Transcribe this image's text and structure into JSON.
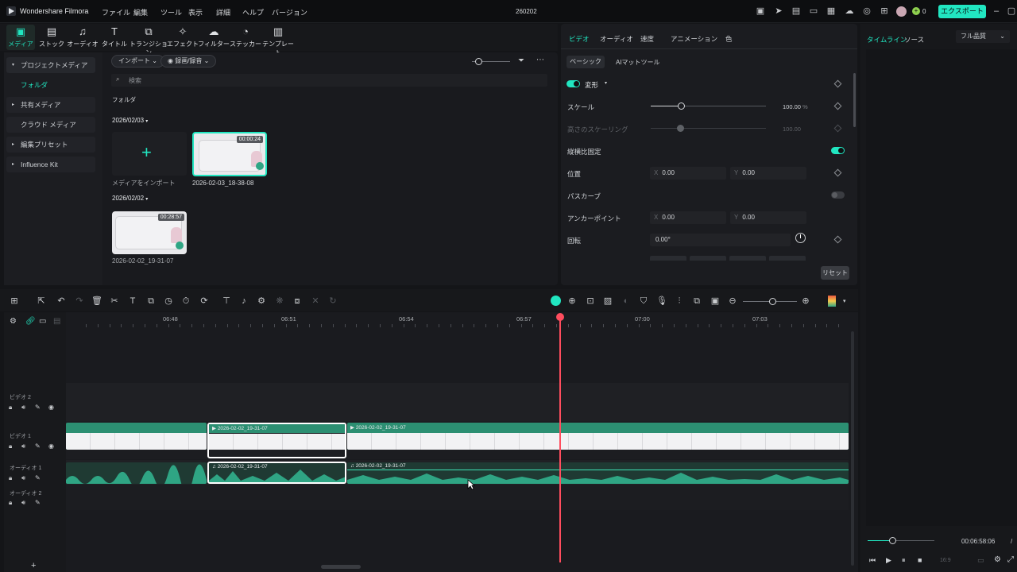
{
  "app": {
    "name": "Wondershare Filmora",
    "project_title": "260202",
    "menu": [
      "ファイル",
      "編集",
      "ツール",
      "表示",
      "詳細",
      "ヘルプ",
      "バージョン"
    ],
    "export_label": "エクスポート",
    "credits": "0"
  },
  "toolbar": {
    "tabs": [
      {
        "label": "メディア",
        "icon": "media-icon"
      },
      {
        "label": "ストック",
        "icon": "stock-icon"
      },
      {
        "label": "オーディオ",
        "icon": "music-note-icon"
      },
      {
        "label": "タイトル",
        "icon": "text-icon"
      },
      {
        "label": "トランジション",
        "icon": "transition-icon"
      },
      {
        "label": "エフェクト",
        "icon": "effect-sparkle-icon"
      },
      {
        "label": "フィルター",
        "icon": "filter-icon"
      },
      {
        "label": "ステッカー",
        "icon": "sticker-icon"
      },
      {
        "label": "テンプレート",
        "icon": "template-icon"
      }
    ]
  },
  "sidebar": {
    "items": [
      {
        "label": "プロジェクトメディア"
      },
      {
        "label": "フォルダ"
      },
      {
        "label": "共有メディア"
      },
      {
        "label": "クラウド メディア"
      },
      {
        "label": "編集プリセット"
      },
      {
        "label": "Influence Kit"
      }
    ]
  },
  "media": {
    "import_label": "インポート",
    "record_label": "録画/録音",
    "search_placeholder": "検索",
    "folder_label": "フォルダ",
    "groups": [
      {
        "date": "2026/02/03",
        "import_tile_label": "メディアをインポート",
        "clip_name": "2026-02-03_18-38-08",
        "clip_duration": "00:00:24"
      },
      {
        "date": "2026/02/02",
        "clip_name": "2026-02-02_19-31-07",
        "clip_duration": "00:28:57"
      }
    ]
  },
  "properties": {
    "tabs": [
      "ビデオ",
      "オーディオ",
      "速度",
      "アニメーション",
      "色"
    ],
    "subtabs": [
      "ベーシック",
      "AIマットツール"
    ],
    "section": "変形",
    "scale_label": "スケール",
    "scale_value": "100.00",
    "scale_unit": "%",
    "scale_fraction": 0.26,
    "height_scale_label": "高さのスケーリング",
    "height_scale_value": "100.00",
    "aspect_label": "縦横比固定",
    "position_label": "位置",
    "position_x": "0.00",
    "position_y": "0.00",
    "path_curve_label": "パスカーブ",
    "anchor_label": "アンカーポイント",
    "anchor_x": "0.00",
    "anchor_y": "0.00",
    "rotation_label": "回転",
    "rotation_value": "0.00°",
    "axis_x": "X",
    "axis_y": "Y",
    "reset_label": "リセット"
  },
  "preview": {
    "tabs": [
      "タイムライン",
      "ソース"
    ],
    "quality": "フル品質",
    "timecode": "00:06:58:06",
    "separator": "/",
    "aspect": "16:9"
  },
  "timeline": {
    "ruler_labels": [
      "06:48",
      "06:51",
      "06:54",
      "06:57",
      "07:00",
      "07:03"
    ],
    "tracks": [
      "ビデオ 2",
      "ビデオ 1",
      "オーディオ 1",
      "オーディオ 2"
    ],
    "clip_name": "2026-02-02_19-31-07",
    "add_label": "+"
  },
  "colors": {
    "accent": "#21e6c1",
    "playhead": "#ff4d5e",
    "audio_wave": "#2fa584",
    "video_track": "#2c8f72"
  }
}
